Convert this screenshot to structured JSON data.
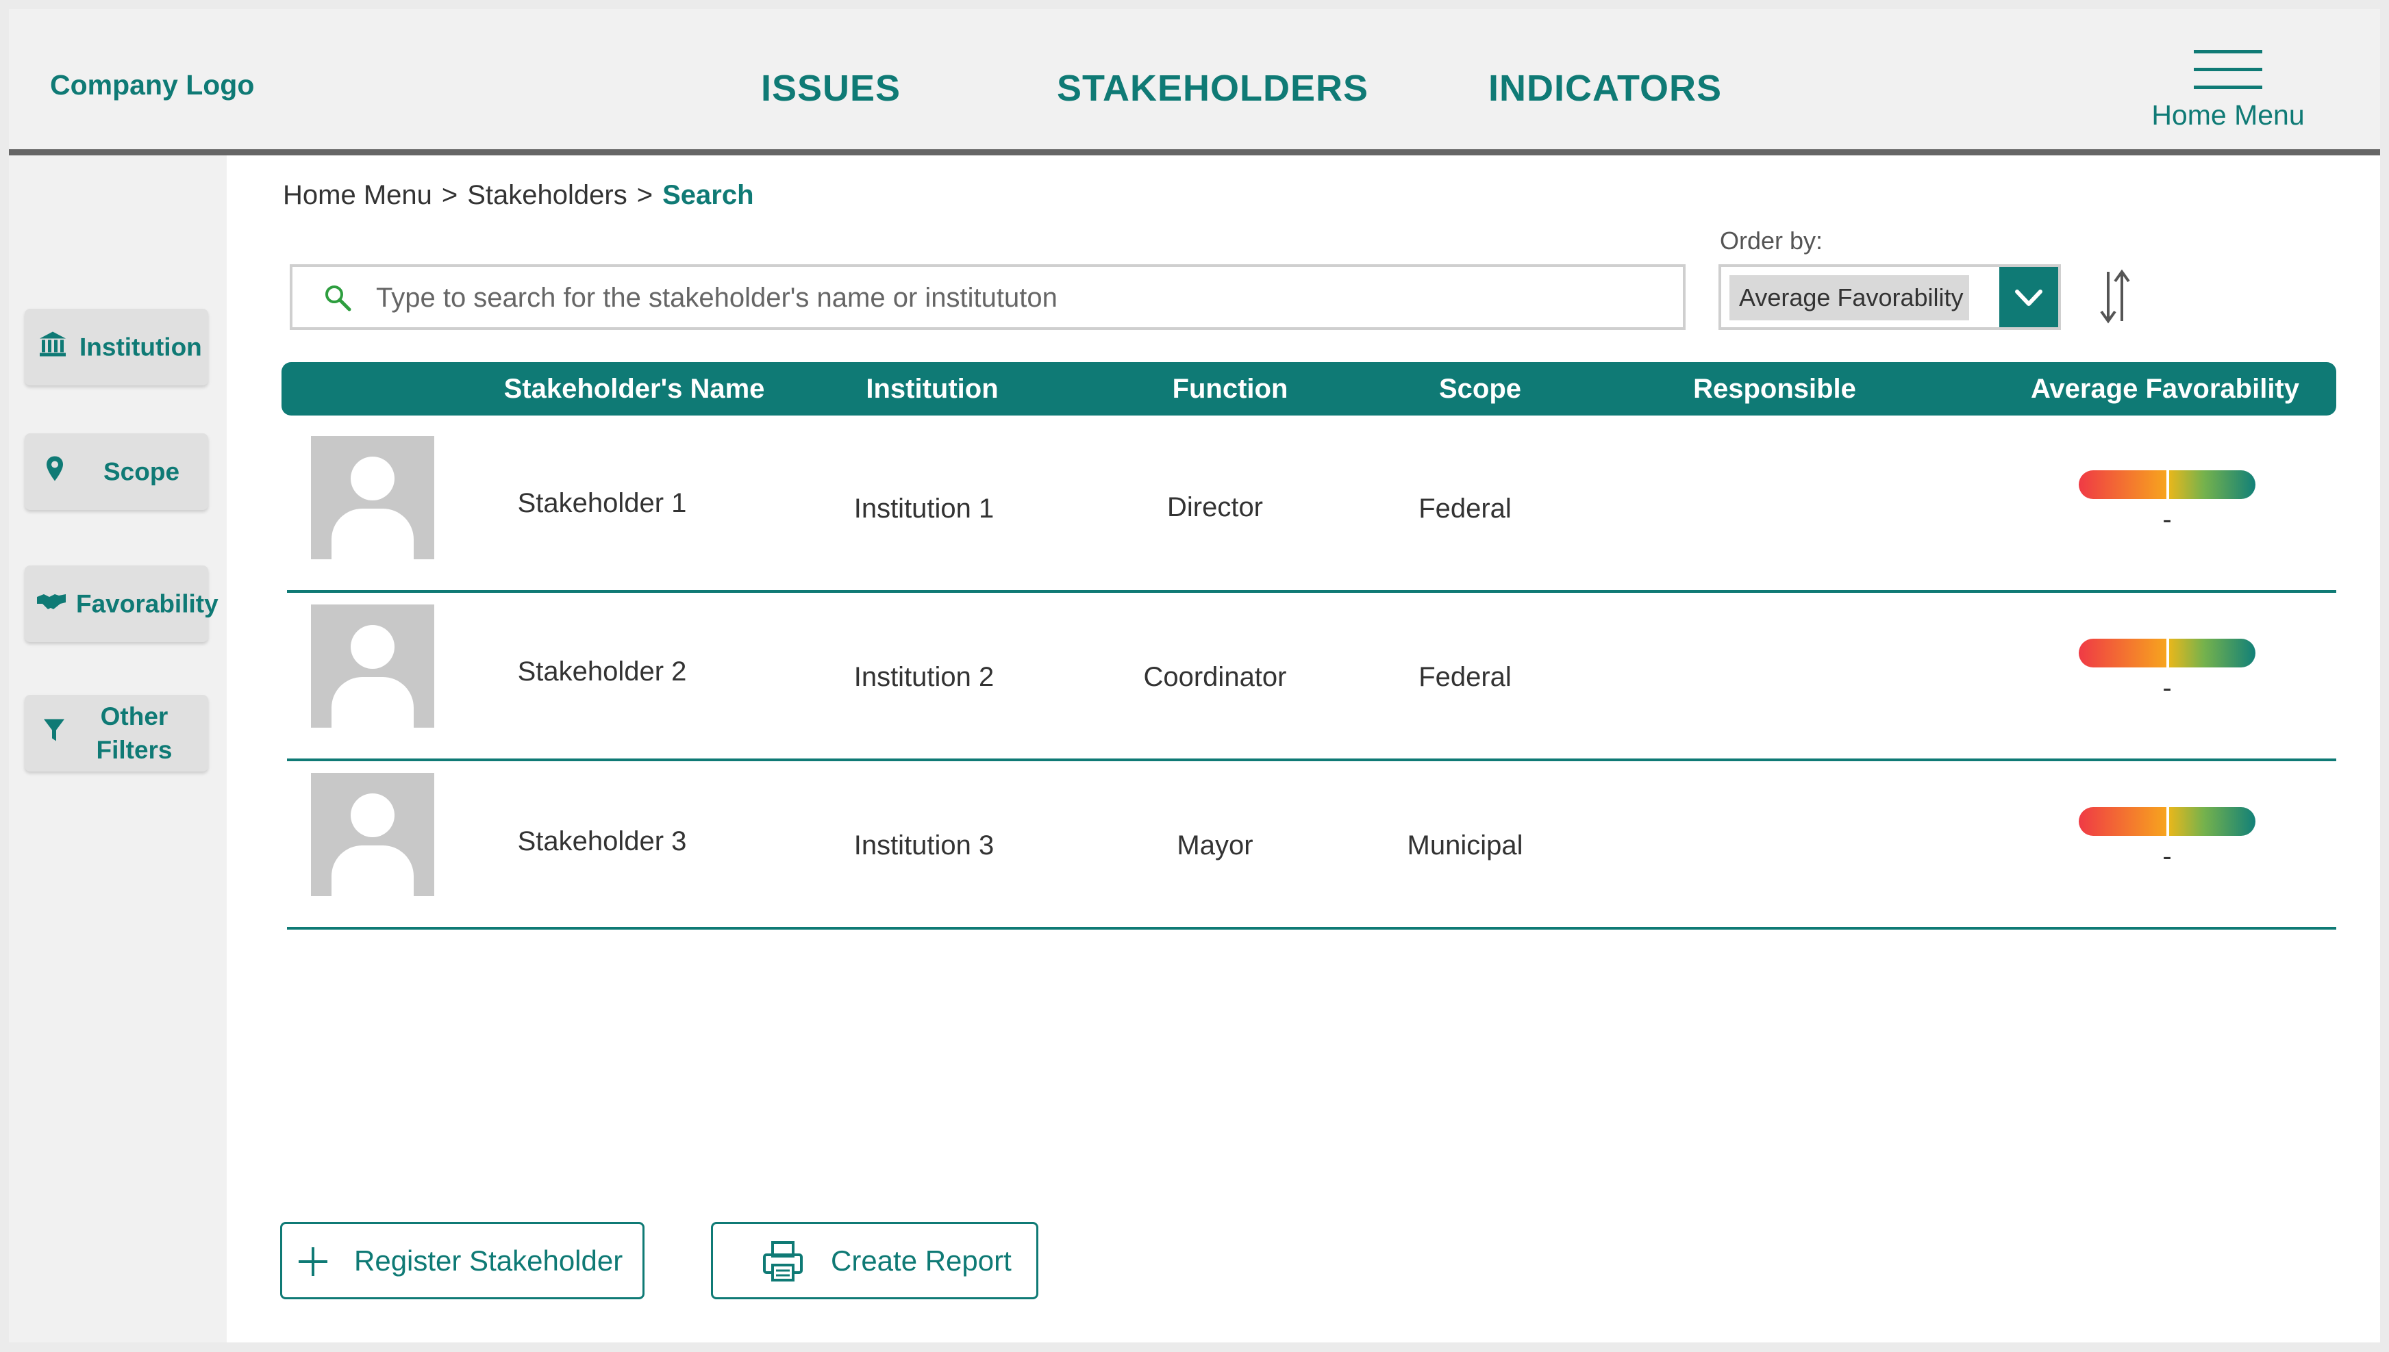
{
  "header": {
    "logo": "Company Logo",
    "nav": [
      "ISSUES",
      "STAKEHOLDERS",
      "INDICATORS"
    ],
    "home_menu": "Home Menu"
  },
  "sidebar": {
    "items": [
      {
        "label": "Institution",
        "icon": "institution-icon"
      },
      {
        "label": "Scope",
        "icon": "location-pin-icon"
      },
      {
        "label": "Favorability",
        "icon": "handshake-icon"
      },
      {
        "label": "Other\nFilters",
        "icon": "filter-icon"
      }
    ]
  },
  "breadcrumb": {
    "items": [
      "Home Menu",
      "Stakeholders"
    ],
    "separator": ">",
    "current": "Search"
  },
  "search": {
    "placeholder": "Type to search for the stakeholder's name or institututon"
  },
  "order": {
    "label": "Order by:",
    "selected": "Average Favorability"
  },
  "table": {
    "columns": [
      "Stakeholder's Name",
      "Institution",
      "Function",
      "Scope",
      "Responsible",
      "Average Favorability"
    ],
    "rows": [
      {
        "name": "Stakeholder 1",
        "institution": "Institution 1",
        "function": "Director",
        "scope": "Federal",
        "responsible": "",
        "favorability": "-"
      },
      {
        "name": "Stakeholder 2",
        "institution": "Institution 2",
        "function": "Coordinator",
        "scope": "Federal",
        "responsible": "",
        "favorability": "-"
      },
      {
        "name": "Stakeholder 3",
        "institution": "Institution 3",
        "function": "Mayor",
        "scope": "Municipal",
        "responsible": "",
        "favorability": "-"
      }
    ]
  },
  "actions": {
    "register": "Register Stakeholder",
    "report": "Create Report"
  },
  "colors": {
    "accent": "#0f7a75",
    "header_bg": "#f1f1f1",
    "sidebar_bg": "#f1f1f1"
  }
}
